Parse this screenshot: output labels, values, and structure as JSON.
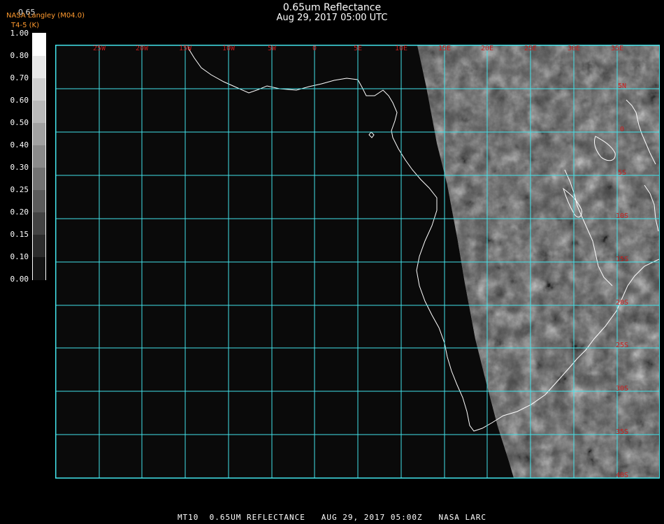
{
  "title": "0.65um Reflectance",
  "subtitle": "Aug 29, 2017 05:00 UTC",
  "credit_line1": "NASA Langley (M04.0)",
  "credit_line2": "T4-5 (K)",
  "colorbar_top_label": "0.65",
  "colorbar_ticks": [
    "1.00",
    "0.80",
    "0.70",
    "0.60",
    "0.50",
    "0.40",
    "0.30",
    "0.25",
    "0.20",
    "0.15",
    "0.10",
    "0.00"
  ],
  "lon_labels": [
    "25W",
    "20W",
    "15W",
    "10W",
    "5W",
    "0",
    "5E",
    "10E",
    "15E",
    "20E",
    "25E",
    "30E",
    "35E"
  ],
  "lat_labels": [
    "5N",
    "0",
    "5S",
    "10S",
    "15S",
    "20S",
    "25S",
    "30S",
    "35S",
    "40S"
  ],
  "footer": "MT10  0.65UM REFLECTANCE   AUG 29, 2017 05:00Z   NASA LARC",
  "colors": {
    "grid": "#43e3ea",
    "label": "#c81e1e",
    "coast": "#ffffff",
    "credit": "#ff9a2e"
  }
}
